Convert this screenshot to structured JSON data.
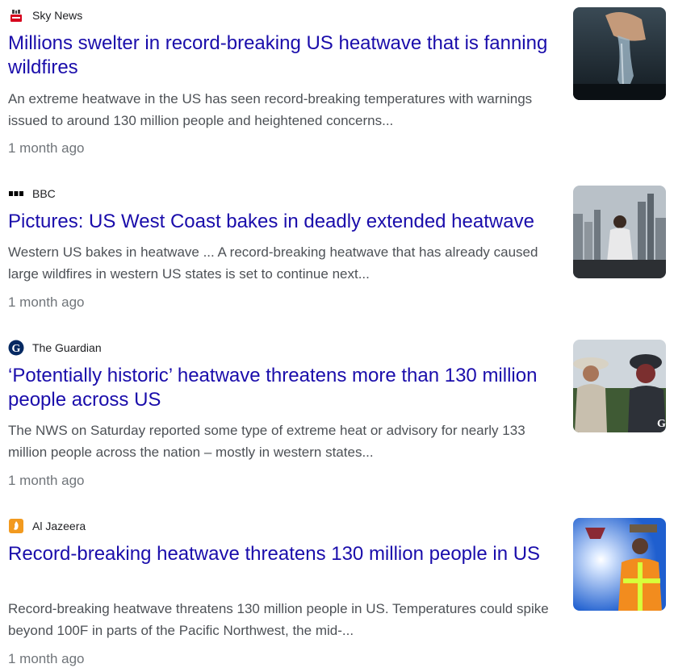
{
  "articles": [
    {
      "source": "Sky News",
      "source_icon": "sky-news-logo",
      "title": "Millions swelter in record-breaking US heatwave that is fanning wildfires",
      "snippet": "An extreme heatwave in the US has seen record-breaking temperatures with warnings issued to around 130 million people and heightened concerns...",
      "time": "1 month ago",
      "thumbnail": "heatwave-water-photo"
    },
    {
      "source": "BBC",
      "source_icon": "bbc-logo",
      "title": "Pictures: US West Coast bakes in deadly extended heatwave",
      "snippet": "Western US bakes in heatwave ... A record-breaking heatwave that has already caused large wildfires in western US states is set to continue next...",
      "time": "1 month ago",
      "thumbnail": "city-skyline-photo"
    },
    {
      "source": "The Guardian",
      "source_icon": "guardian-logo",
      "title": "‘Potentially historic’ heatwave threatens more than 130 million people across US",
      "snippet": "The NWS on Saturday reported some type of extreme heat or advisory for nearly 133 million people across the nation – mostly in western states...",
      "time": "1 month ago",
      "thumbnail": "people-in-hats-photo"
    },
    {
      "source": "Al Jazeera",
      "source_icon": "al-jazeera-logo",
      "title": "Record-breaking heatwave threatens 130 million people in US",
      "snippet": "Record-breaking heatwave threatens 130 million people in US. Temperatures could spike beyond 100F in parts of the Pacific Northwest, the mid-...",
      "time": "1 month ago",
      "thumbnail": "worker-sun-photo"
    }
  ],
  "colors": {
    "headline": "#1a0dab",
    "snippet": "#4d5156",
    "time": "#70757a",
    "source": "#202124"
  }
}
